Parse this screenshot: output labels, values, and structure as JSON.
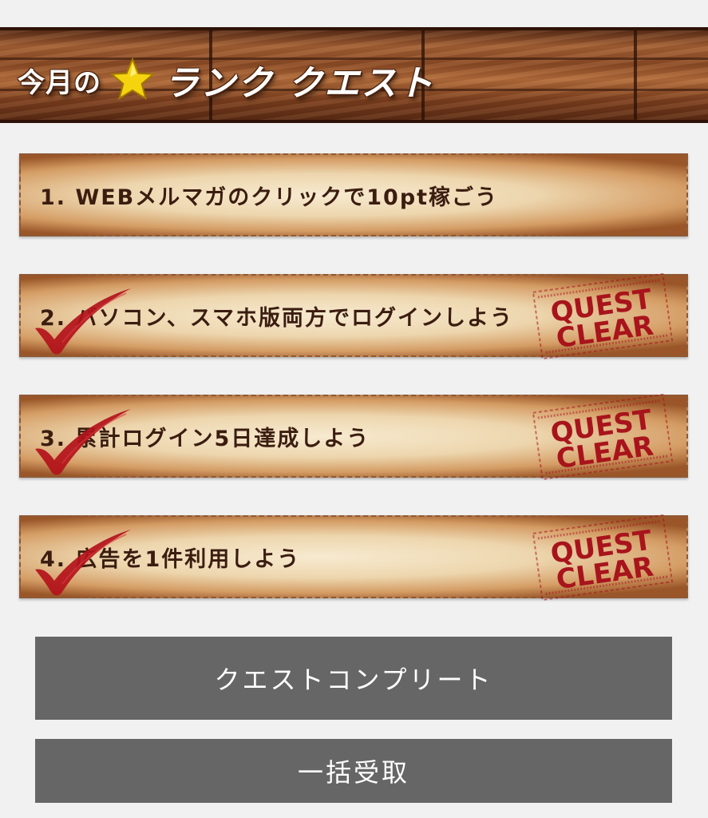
{
  "header": {
    "prefix": "今月の",
    "title": "ランク クエスト",
    "star_icon": "star-icon",
    "star_color": "#f5d30f"
  },
  "quests": [
    {
      "label": "1. WEBメルマガのクリックで10pt稼ごう",
      "cleared": false
    },
    {
      "label": "2. パソコン、スマホ版両方でログインしよう",
      "cleared": true
    },
    {
      "label": "3. 累計ログイン5日達成しよう",
      "cleared": true
    },
    {
      "label": "4. 広告を1件利用しよう",
      "cleared": true
    }
  ],
  "stamp": {
    "line1": "QUEST",
    "line2": "CLEAR",
    "color": "#a8141c"
  },
  "check": {
    "icon": "checkmark-icon",
    "color": "#b3121b"
  },
  "buttons": {
    "complete_label": "クエストコンプリート",
    "receive_all_label": "一括受取",
    "color": "#666666"
  }
}
